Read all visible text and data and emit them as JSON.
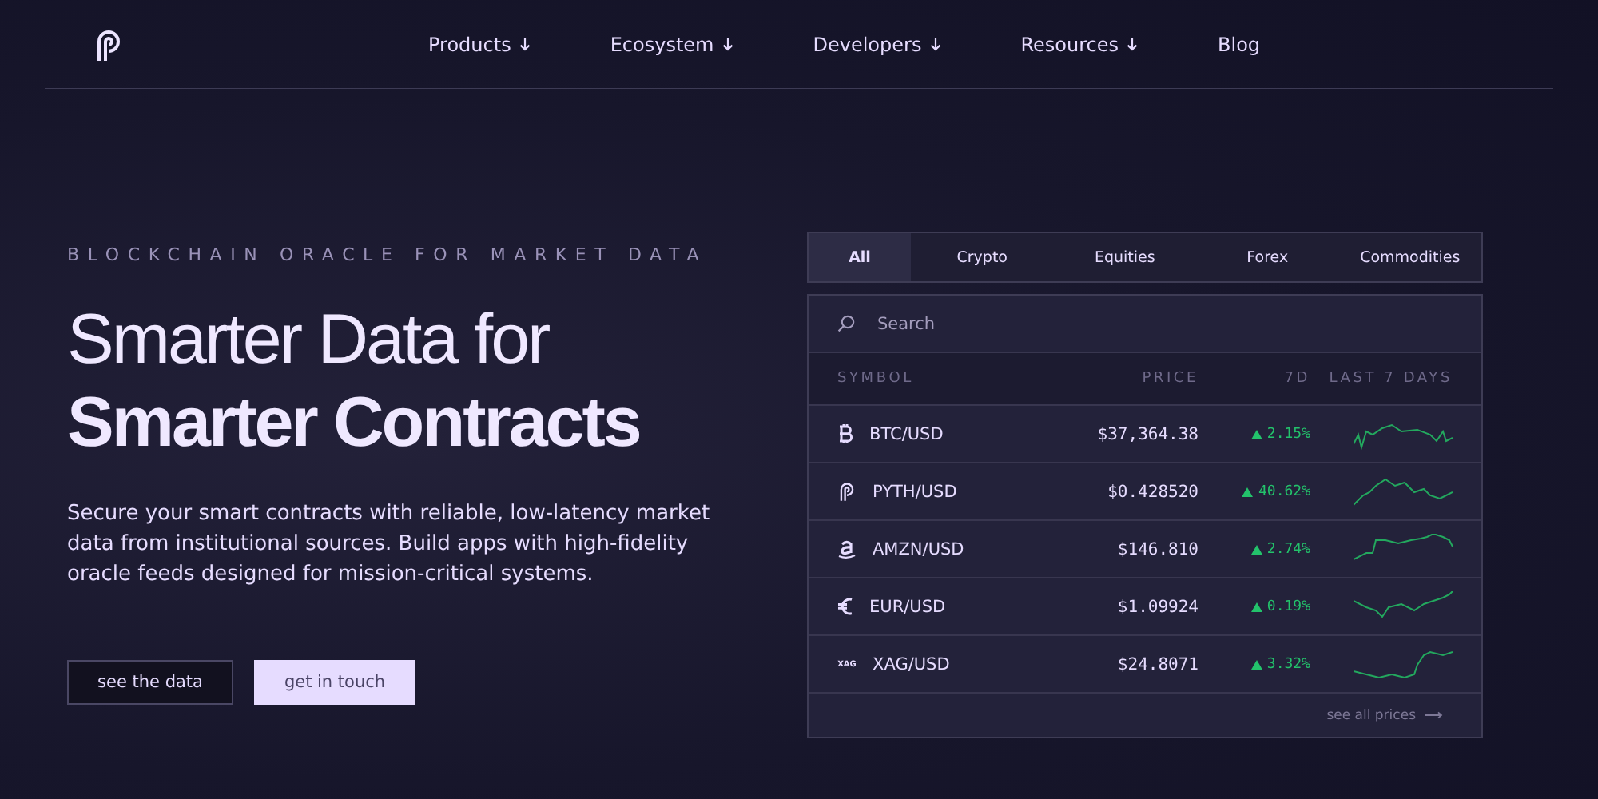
{
  "nav": {
    "items": [
      {
        "label": "Products",
        "dropdown": true
      },
      {
        "label": "Ecosystem",
        "dropdown": true
      },
      {
        "label": "Developers",
        "dropdown": true
      },
      {
        "label": "Resources",
        "dropdown": true
      },
      {
        "label": "Blog",
        "dropdown": false
      }
    ]
  },
  "hero": {
    "eyebrow": "BLOCKCHAIN ORACLE FOR MARKET DATA",
    "headline_light": "Smarter Data for",
    "headline_bold": "Smarter Contracts",
    "description": "Secure your smart contracts with reliable, low-latency market data from institutional sources. Build apps with high-fidelity oracle feeds designed for mission-critical systems.",
    "buttons": [
      {
        "label": "see the data",
        "kind": "outline"
      },
      {
        "label": "get in touch",
        "kind": "filled"
      }
    ]
  },
  "prices": {
    "tabs": [
      {
        "label": "All",
        "selected": true
      },
      {
        "label": "Crypto",
        "selected": false
      },
      {
        "label": "Equities",
        "selected": false
      },
      {
        "label": "Forex",
        "selected": false
      },
      {
        "label": "Commodities",
        "selected": false
      }
    ],
    "search": {
      "placeholder": "Search"
    },
    "columns": [
      "SYMBOL",
      "PRICE",
      "7D",
      "LAST 7 DAYS"
    ],
    "rows": [
      {
        "kind": "bitcoin",
        "symbol": "BTC/USD",
        "price": "$37,364.38",
        "change": "2.15%"
      },
      {
        "kind": "pyth",
        "symbol": "PYTH/USD",
        "price": "$0.428520",
        "change": "40.62%"
      },
      {
        "kind": "amazon",
        "symbol": "AMZN/USD",
        "price": "$146.810",
        "change": "2.74%"
      },
      {
        "kind": "euro",
        "symbol": "EUR/USD",
        "price": "$1.09924",
        "change": "0.19%"
      },
      {
        "kind": "ticker",
        "icon_text": "XAG",
        "symbol": "XAG/USD",
        "price": "$24.8071",
        "change": "3.32%"
      }
    ],
    "footer_link": "see all prices"
  }
}
